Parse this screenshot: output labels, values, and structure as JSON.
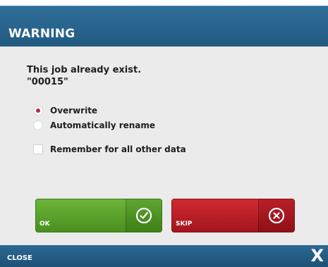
{
  "dialog": {
    "title": "WARNING",
    "message_line1": "This job already exist.",
    "message_line2": "\"00015\"",
    "options": [
      {
        "label": "Overwrite",
        "selected": true
      },
      {
        "label": "Automatically rename",
        "selected": false
      }
    ],
    "remember": {
      "label": "Remember for all other data",
      "checked": false
    },
    "buttons": {
      "ok_label": "OK",
      "skip_label": "SKIP"
    },
    "footer": {
      "close_label": "CLOSE",
      "close_glyph": "X"
    }
  },
  "colors": {
    "header": "#2e6e99",
    "body": "#ebebeb",
    "ok_green": "#5aa12c",
    "skip_red": "#c0222a",
    "radio_selected": "#c62848"
  },
  "icons": {
    "ok_icon": "check-circle-icon",
    "skip_icon": "x-circle-icon"
  }
}
